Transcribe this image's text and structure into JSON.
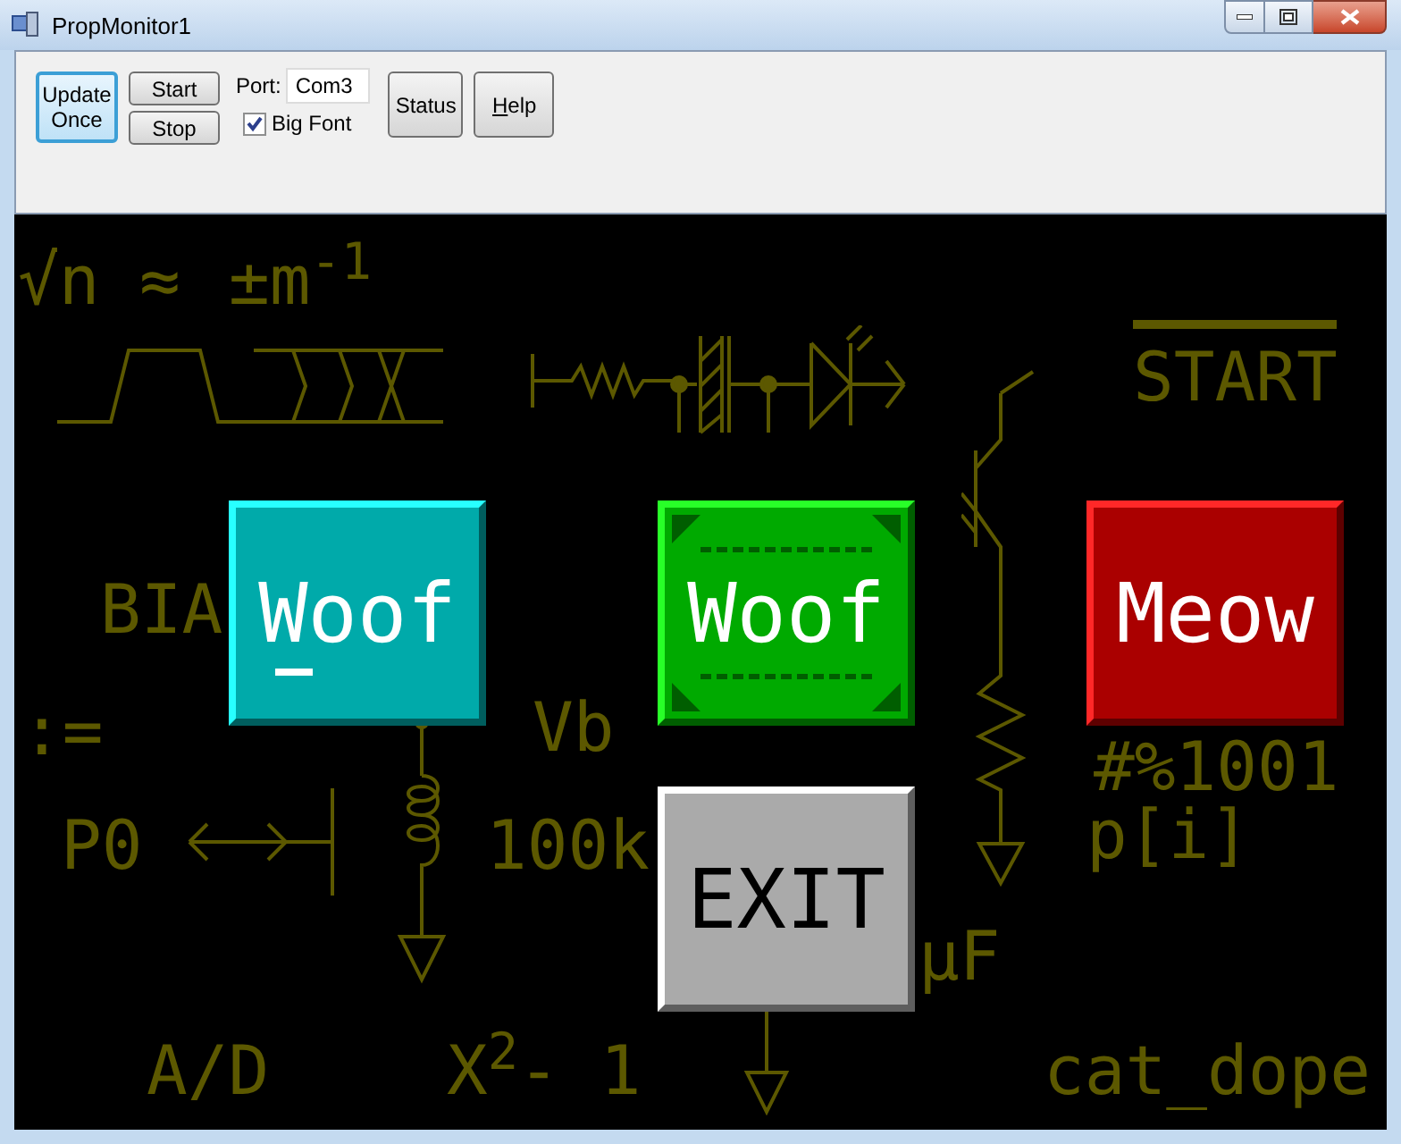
{
  "window": {
    "title": "PropMonitor1"
  },
  "toolbar": {
    "update_button": {
      "label": "Update Once",
      "focused": true
    },
    "start_button": {
      "label": "Start"
    },
    "stop_button": {
      "label": "Stop"
    },
    "port": {
      "label": "Port:",
      "value": "Com3"
    },
    "big_font": {
      "label": "Big Font",
      "checked": true
    },
    "status_button": {
      "label": "Status"
    },
    "help_button": {
      "label": "Help"
    }
  },
  "canvas_labels": [
    {
      "text": "√n"
    },
    {
      "text": "≈"
    },
    {
      "text": "±m$^{-1}$"
    },
    {
      "text": "START",
      "overline": true
    },
    {
      "text": "BIA"
    },
    {
      "text": ":="
    },
    {
      "text": "Vb"
    },
    {
      "text": "#%1001"
    },
    {
      "text": "P0"
    },
    {
      "text": "100k"
    },
    {
      "text": "p[i]"
    },
    {
      "text": "µF"
    },
    {
      "text": "A/D"
    },
    {
      "text": "X$^{2}$- 1"
    },
    {
      "text": "cat_dope"
    }
  ],
  "canvas_buttons": [
    {
      "label": "Woof",
      "color": "#00aaaa",
      "kind": "plain",
      "focused": true
    },
    {
      "label": "Woof",
      "color": "#00aa00",
      "kind": "framed",
      "focused": false
    },
    {
      "label": "Meow",
      "color": "#aa0000",
      "kind": "plain",
      "focused": false
    },
    {
      "label": "EXIT",
      "color": "#aaaaaa",
      "kind": "plain",
      "focused": false
    }
  ]
}
